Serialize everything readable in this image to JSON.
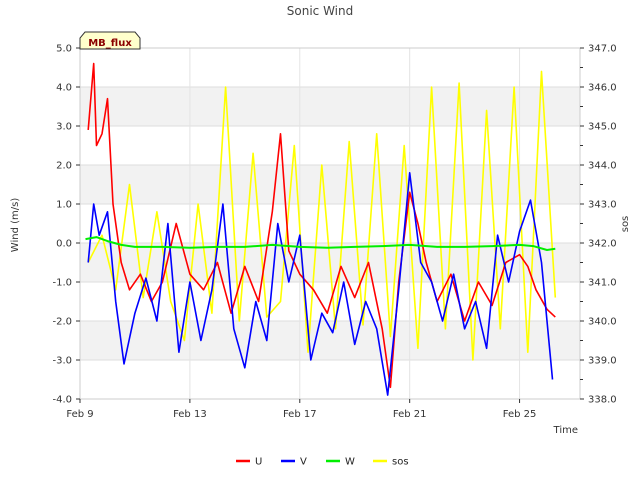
{
  "chart_data": {
    "type": "line",
    "title": "Sonic Wind",
    "tag": "MB_flux",
    "xlabel": "Time",
    "ylabel_left": "Wind (m/s)",
    "ylabel_right": "sos",
    "x_ticks": [
      "Feb 9",
      "Feb 13",
      "Feb 17",
      "Feb 21",
      "Feb 25"
    ],
    "x_tick_days": [
      9,
      13,
      17,
      21,
      25
    ],
    "xlim": [
      9,
      27.2
    ],
    "ylim_left": [
      -4.0,
      5.0
    ],
    "ylim_right": [
      338.0,
      347.0
    ],
    "y_ticks_left": [
      "-4.0",
      "-3.0",
      "-2.0",
      "-1.0",
      "0.0",
      "1.0",
      "2.0",
      "3.0",
      "4.0",
      "5.0"
    ],
    "y_ticks_right": [
      "338.0",
      "339.0",
      "340.0",
      "341.0",
      "342.0",
      "343.0",
      "344.0",
      "345.0",
      "346.0",
      "347.0"
    ],
    "grid": true,
    "legend_position": "bottom-center",
    "series": [
      {
        "name": "U",
        "color": "#ff0000",
        "axis": "left",
        "x": [
          9.3,
          9.5,
          9.6,
          9.8,
          10.0,
          10.2,
          10.5,
          10.8,
          11.2,
          11.6,
          12.0,
          12.5,
          13.0,
          13.5,
          14.0,
          14.5,
          15.0,
          15.5,
          16.0,
          16.3,
          16.6,
          17.0,
          17.5,
          18.0,
          18.5,
          19.0,
          19.5,
          20.0,
          20.3,
          20.6,
          21.0,
          21.3,
          21.6,
          22.0,
          22.5,
          23.0,
          23.5,
          24.0,
          24.5,
          25.0,
          25.3,
          25.6,
          26.0,
          26.3
        ],
        "y": [
          2.9,
          4.6,
          2.5,
          2.8,
          3.7,
          1.0,
          -0.5,
          -1.2,
          -0.8,
          -1.5,
          -1.0,
          0.5,
          -0.8,
          -1.2,
          -0.5,
          -1.8,
          -0.6,
          -1.5,
          0.8,
          2.8,
          -0.2,
          -0.8,
          -1.2,
          -1.8,
          -0.6,
          -1.4,
          -0.5,
          -2.2,
          -3.7,
          -1.0,
          1.3,
          0.5,
          -0.5,
          -1.5,
          -0.8,
          -2.0,
          -1.0,
          -1.6,
          -0.5,
          -0.3,
          -0.6,
          -1.2,
          -1.7,
          -1.9
        ]
      },
      {
        "name": "V",
        "color": "#0000ff",
        "axis": "left",
        "x": [
          9.3,
          9.5,
          9.7,
          10.0,
          10.3,
          10.6,
          11.0,
          11.4,
          11.8,
          12.2,
          12.6,
          13.0,
          13.4,
          13.8,
          14.2,
          14.6,
          15.0,
          15.4,
          15.8,
          16.2,
          16.6,
          17.0,
          17.4,
          17.8,
          18.2,
          18.6,
          19.0,
          19.4,
          19.8,
          20.2,
          20.6,
          21.0,
          21.4,
          21.8,
          22.2,
          22.6,
          23.0,
          23.4,
          23.8,
          24.2,
          24.6,
          25.0,
          25.4,
          25.8,
          26.2
        ],
        "y": [
          -0.5,
          1.0,
          0.2,
          0.8,
          -1.5,
          -3.1,
          -1.8,
          -0.9,
          -2.0,
          0.5,
          -2.8,
          -1.0,
          -2.5,
          -1.2,
          1.0,
          -2.2,
          -3.2,
          -1.5,
          -2.5,
          0.5,
          -1.0,
          0.2,
          -3.0,
          -1.8,
          -2.3,
          -1.0,
          -2.6,
          -1.5,
          -2.2,
          -3.9,
          -1.2,
          1.8,
          -0.5,
          -1.0,
          -2.0,
          -0.8,
          -2.2,
          -1.5,
          -2.7,
          0.2,
          -1.0,
          0.3,
          1.1,
          -0.5,
          -3.5
        ]
      },
      {
        "name": "W",
        "color": "#00ee00",
        "axis": "left",
        "x": [
          9.2,
          9.6,
          10.0,
          10.5,
          11.0,
          12.0,
          13.0,
          14.0,
          15.0,
          16.0,
          17.0,
          18.0,
          19.0,
          20.0,
          21.0,
          22.0,
          23.0,
          24.0,
          25.0,
          25.5,
          26.0,
          26.3
        ],
        "y": [
          0.1,
          0.15,
          0.05,
          -0.05,
          -0.1,
          -0.1,
          -0.12,
          -0.1,
          -0.1,
          -0.05,
          -0.1,
          -0.12,
          -0.1,
          -0.08,
          -0.05,
          -0.1,
          -0.1,
          -0.08,
          -0.05,
          -0.08,
          -0.18,
          -0.15
        ]
      },
      {
        "name": "sos",
        "color": "#ffff00",
        "axis": "right",
        "x": [
          9.3,
          9.8,
          10.3,
          10.8,
          11.3,
          11.8,
          12.3,
          12.8,
          13.3,
          13.8,
          14.3,
          14.8,
          15.3,
          15.8,
          16.3,
          16.8,
          17.3,
          17.8,
          18.3,
          18.8,
          19.3,
          19.8,
          20.3,
          20.8,
          21.3,
          21.8,
          22.3,
          22.8,
          23.3,
          23.8,
          24.3,
          24.8,
          25.3,
          25.8,
          26.3
        ],
        "y": [
          341.5,
          342.2,
          340.8,
          343.5,
          340.6,
          342.8,
          340.5,
          339.5,
          343.0,
          340.2,
          346.0,
          340.0,
          344.3,
          340.1,
          340.5,
          344.5,
          339.2,
          344.0,
          339.8,
          344.6,
          339.9,
          344.8,
          339.6,
          344.5,
          339.3,
          346.0,
          339.8,
          346.1,
          339.0,
          345.4,
          339.8,
          346.0,
          339.2,
          346.4,
          340.6
        ]
      }
    ]
  }
}
